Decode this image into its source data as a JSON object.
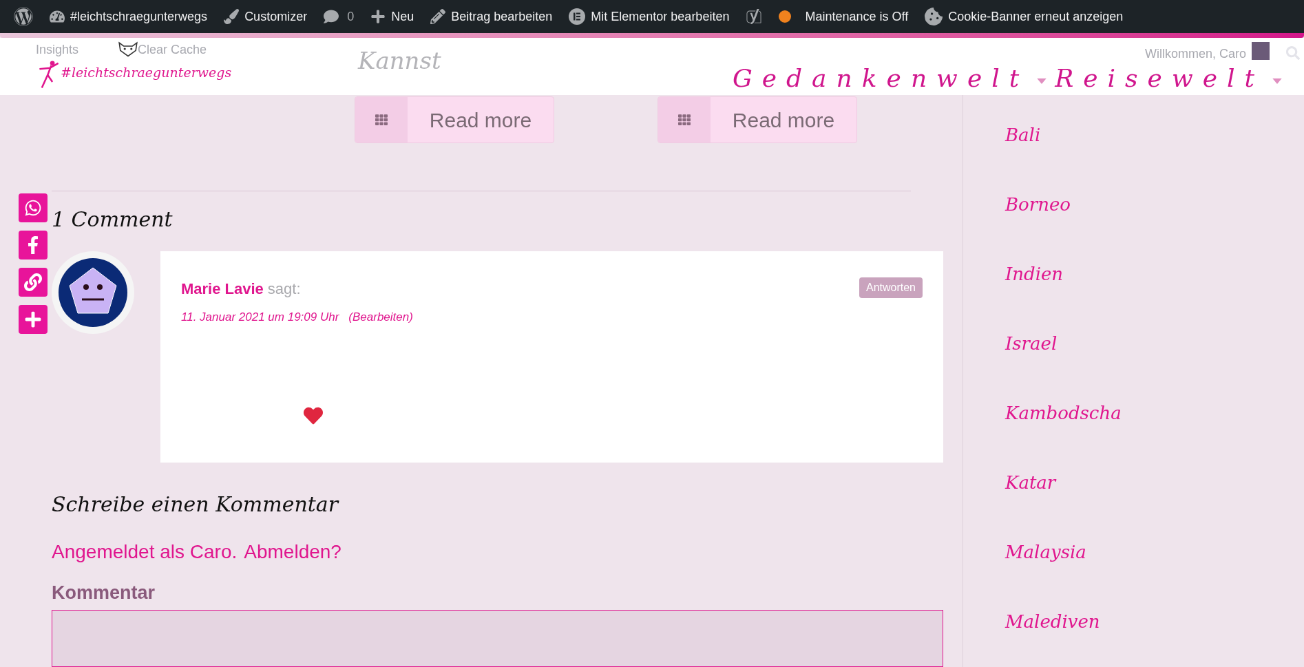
{
  "admin_bar": {
    "items": [
      {
        "kind": "wordpress"
      },
      {
        "kind": "dashboard",
        "label": "#leichtschraegunterwegs"
      },
      {
        "kind": "customizer",
        "label": "Customizer"
      },
      {
        "kind": "comments",
        "label": "0"
      },
      {
        "kind": "new",
        "label": "Neu"
      },
      {
        "kind": "edit",
        "label": "Beitrag bearbeiten"
      },
      {
        "kind": "elementor",
        "label": "Mit Elementor bearbeiten"
      },
      {
        "kind": "seo"
      },
      {
        "kind": "status",
        "label": "Maintenance is Off",
        "color": "#f0821e"
      },
      {
        "kind": "cookie",
        "label": "Cookie-Banner erneut anzeigen"
      }
    ]
  },
  "header": {
    "logo": "#leichtschraegunterwegs",
    "faded_texts": [
      "Insights",
      "Clear Cache",
      "Kannst"
    ],
    "welcome": "Willkommen, Caro",
    "nav": [
      {
        "label": "Gedankenwelt",
        "has_submenu": true
      },
      {
        "label": "Reisewelt",
        "has_submenu": true
      }
    ]
  },
  "read_more_buttons": [
    "Read more",
    "Read more"
  ],
  "share_buttons": [
    {
      "kind": "whatsapp"
    },
    {
      "kind": "facebook"
    },
    {
      "kind": "link"
    },
    {
      "kind": "more"
    }
  ],
  "comments": {
    "title": "1 Comment",
    "items": [
      {
        "author": "Marie Lavie",
        "says": "sagt:",
        "date": "11. Januar 2021 um 19:09 Uhr",
        "edit": "(Bearbeiten)",
        "reply": "Antworten"
      }
    ]
  },
  "reply_form": {
    "title": "Schreibe einen Kommentar",
    "logged_in": "Angemeldet als Caro.",
    "logout": "Abmelden?",
    "label": "Kommentar"
  },
  "sidebar": {
    "items": [
      "Bali",
      "Borneo",
      "Indien",
      "Israel",
      "Kambodscha",
      "Katar",
      "Malaysia",
      "Malediven"
    ]
  }
}
